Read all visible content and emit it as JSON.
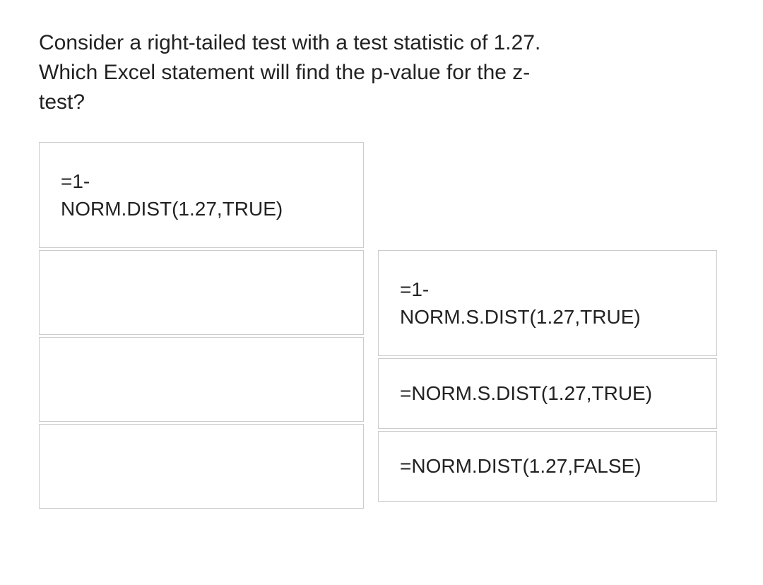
{
  "question": "Consider a right-tailed test with a test statistic of 1.27. Which Excel statement will find the p-value for the z-test?",
  "left": {
    "cell1_line1": "=1-",
    "cell1_line2": "NORM.DIST(1.27,TRUE)"
  },
  "right": {
    "cell1_line1": "=1-",
    "cell1_line2": "NORM.S.DIST(1.27,TRUE)",
    "cell2": "=NORM.S.DIST(1.27,TRUE)",
    "cell3": "=NORM.DIST(1.27,FALSE)"
  }
}
